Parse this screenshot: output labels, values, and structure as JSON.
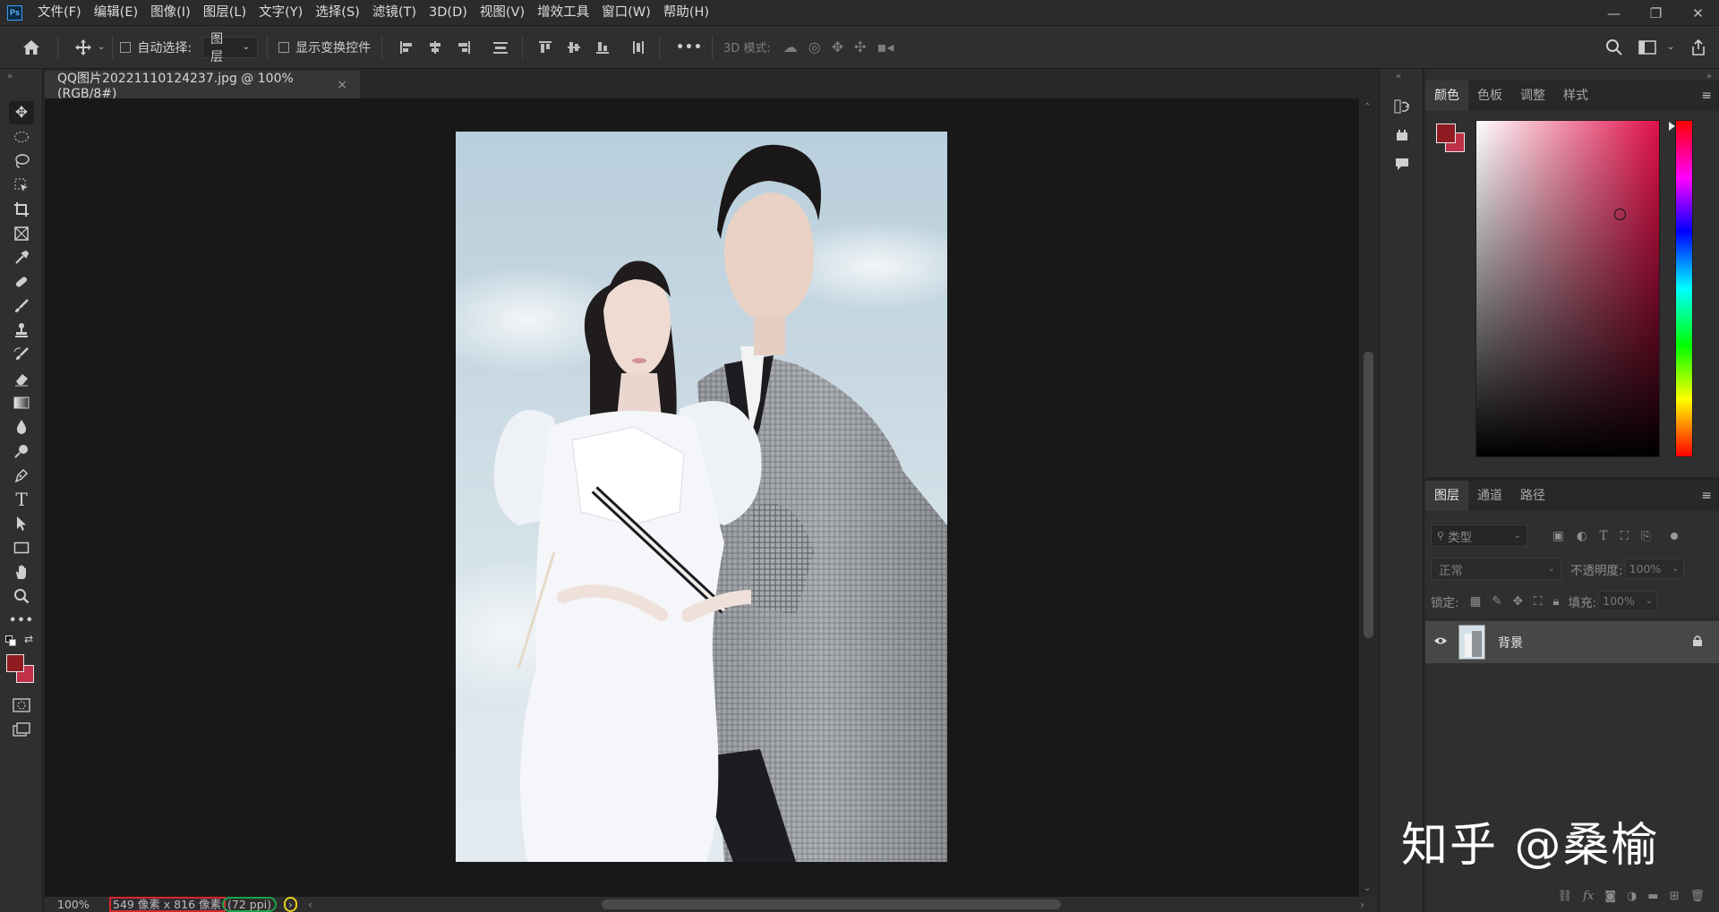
{
  "app": {
    "logo": "Ps"
  },
  "menu": [
    "文件(F)",
    "编辑(E)",
    "图像(I)",
    "图层(L)",
    "文字(Y)",
    "选择(S)",
    "滤镜(T)",
    "3D(D)",
    "视图(V)",
    "增效工具",
    "窗口(W)",
    "帮助(H)"
  ],
  "window_controls": [
    "—",
    "❐",
    "✕"
  ],
  "options": {
    "auto_select_label": "自动选择:",
    "auto_select_value": "图层",
    "show_transform_label": "显示变换控件",
    "mode_3d_label": "3D 模式:",
    "more": "•••"
  },
  "document": {
    "tab_title": "QQ图片20221110124237.jpg @ 100%(RGB/8#)",
    "close": "×"
  },
  "status": {
    "zoom": "100%",
    "size": "549 像素 x 816 像素",
    "ppi": "(72 ppi)",
    "arrow": "›",
    "left_arrow": "‹",
    "right_arrow": "›"
  },
  "color_panel": {
    "tabs": [
      "颜色",
      "色板",
      "调整",
      "样式"
    ],
    "foreground": "#8e1a22",
    "background": "#c03048",
    "hue_color": "#e0104a"
  },
  "layers_panel": {
    "tabs": [
      "图层",
      "通道",
      "路径"
    ],
    "filter_placeholder": "类型",
    "blend_mode": "正常",
    "opacity_label": "不透明度:",
    "opacity_value": "100%",
    "lock_label": "锁定:",
    "fill_label": "填充:",
    "fill_value": "100%",
    "layers": [
      {
        "name": "背景",
        "visible": true,
        "locked": true
      }
    ]
  },
  "watermark": "知乎 @桑榆"
}
